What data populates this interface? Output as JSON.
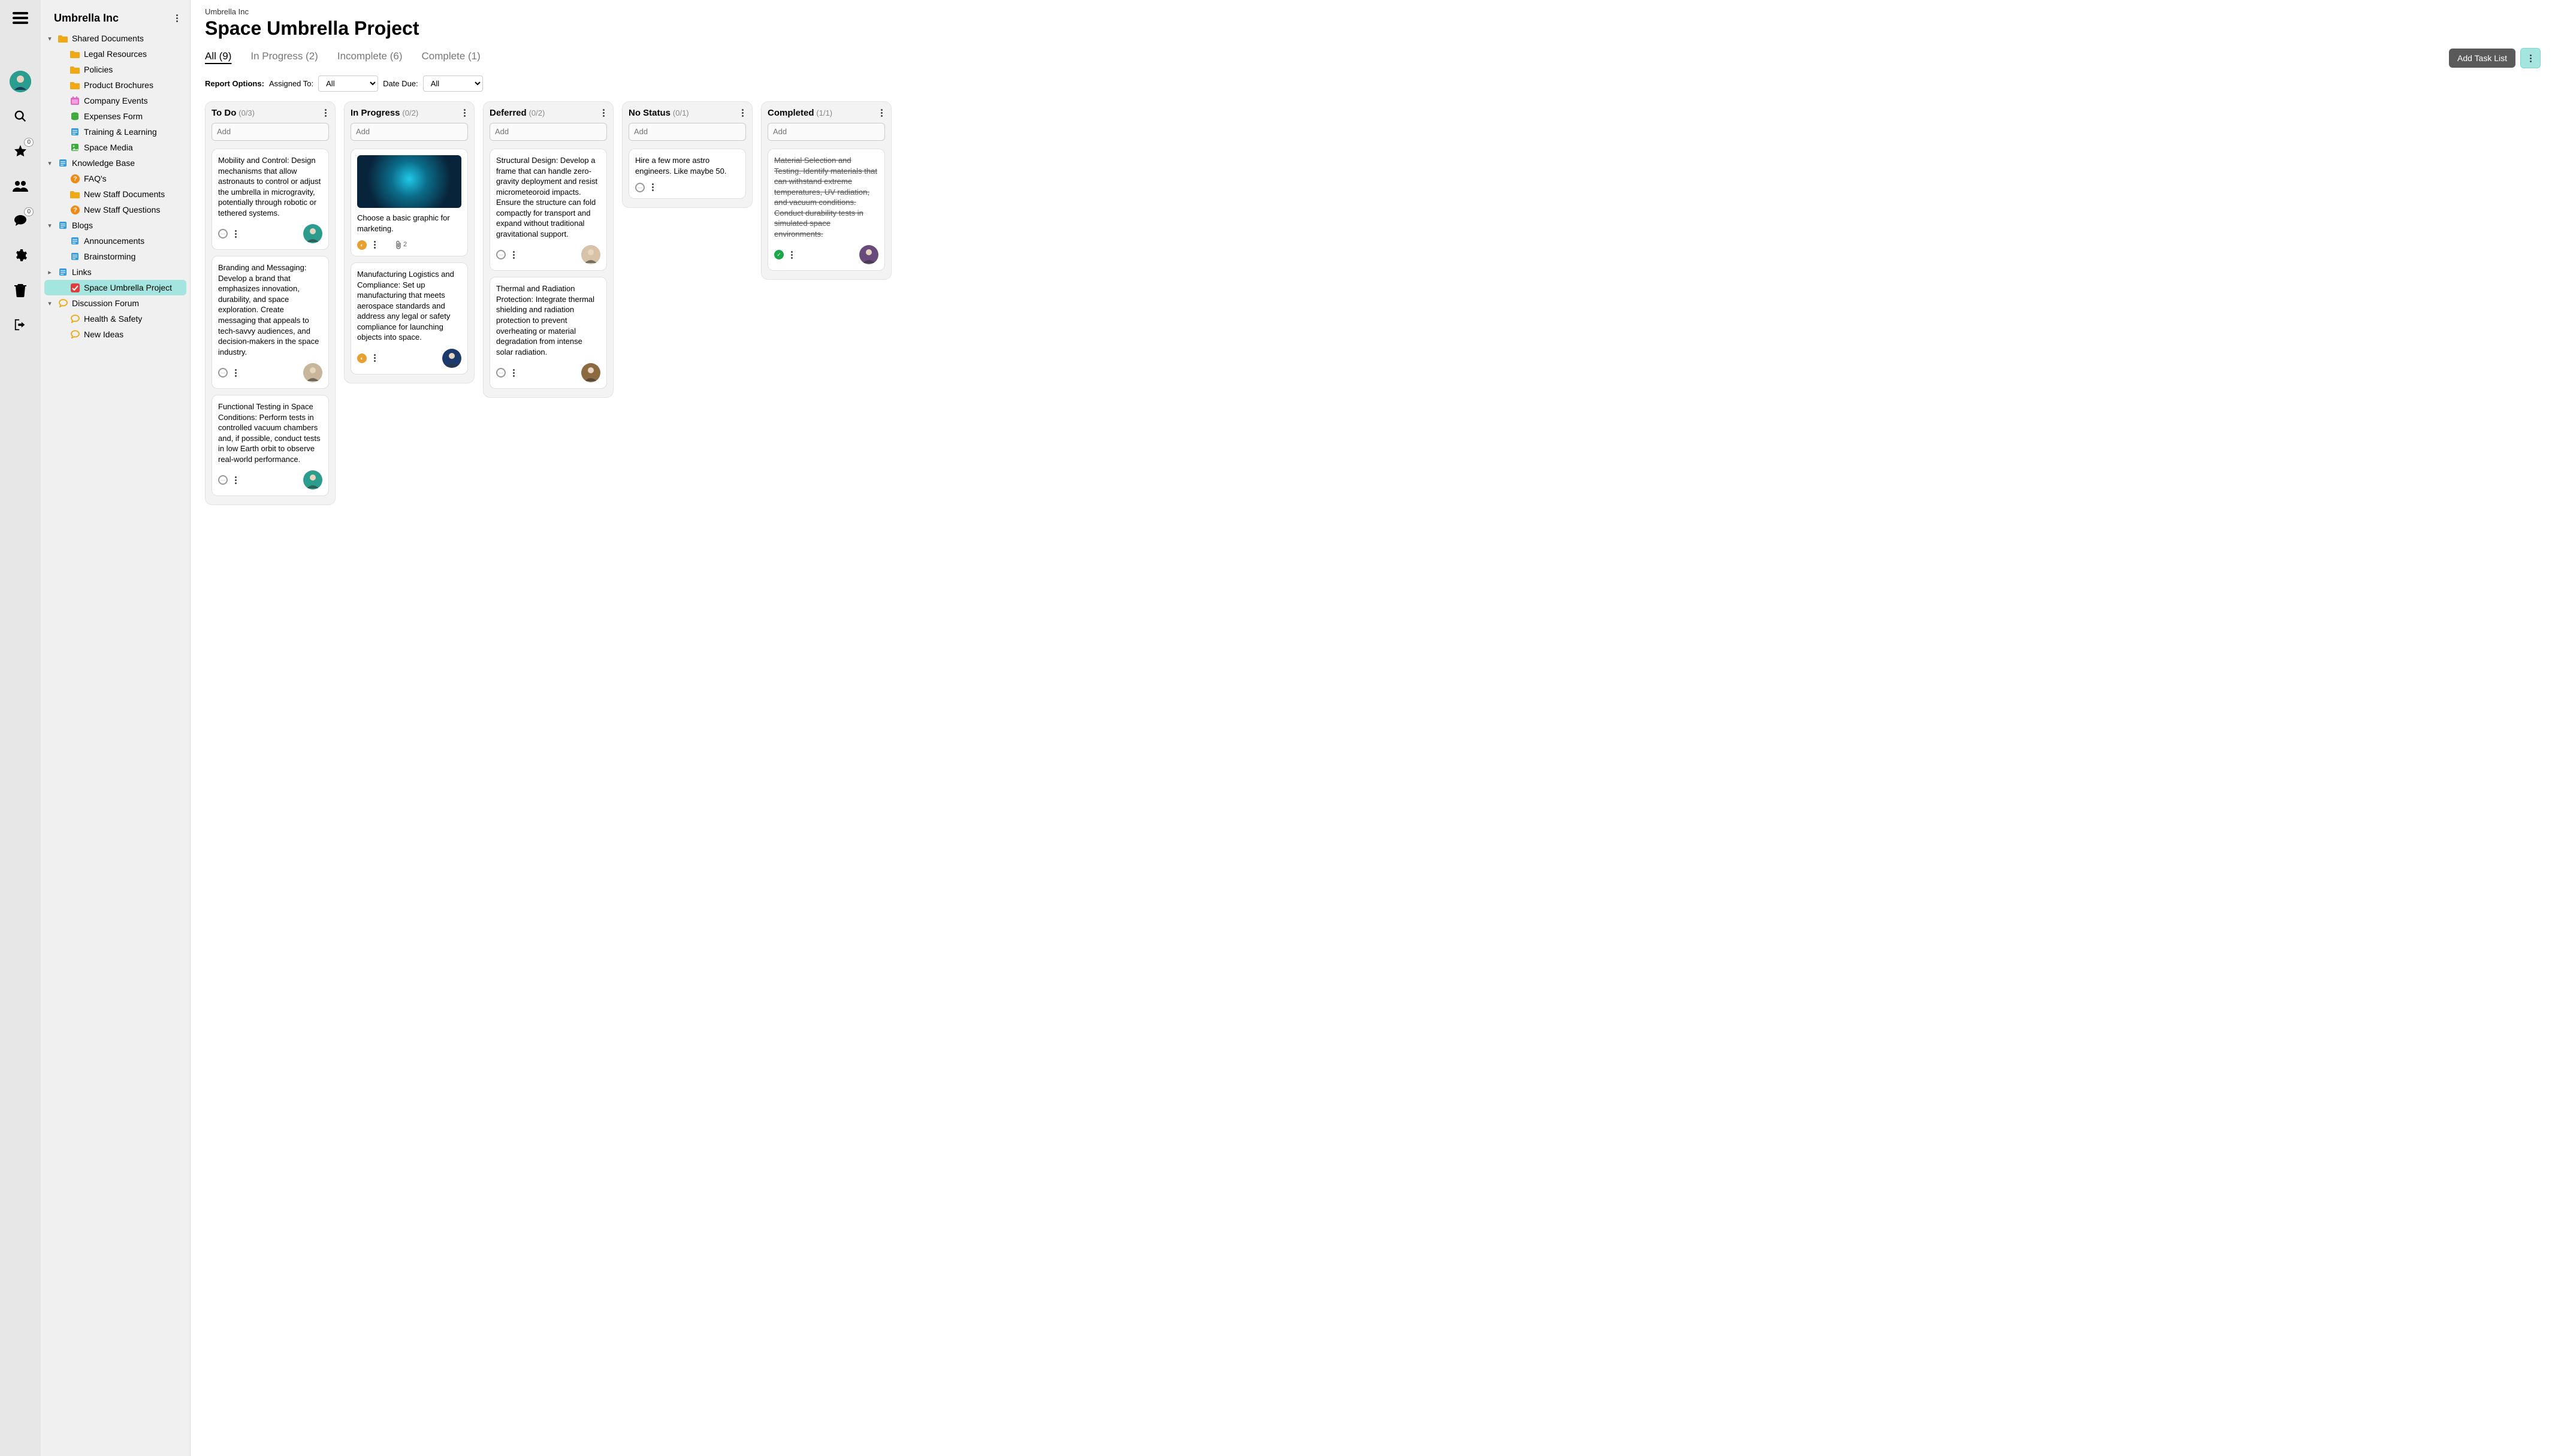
{
  "org": "Umbrella Inc",
  "project_title": "Space Umbrella Project",
  "rail": {
    "star_badge": "0",
    "chat_badge": "0"
  },
  "tree": {
    "nodes": [
      {
        "depth": 0,
        "caret": "▾",
        "icon": "folder",
        "iconClass": "folder-yellow",
        "label": "Shared Documents"
      },
      {
        "depth": 1,
        "caret": "",
        "icon": "folder",
        "iconClass": "folder-yellow",
        "label": "Legal Resources"
      },
      {
        "depth": 1,
        "caret": "",
        "icon": "folder",
        "iconClass": "folder-yellow",
        "label": "Policies"
      },
      {
        "depth": 1,
        "caret": "",
        "icon": "folder",
        "iconClass": "folder-yellow",
        "label": "Product Brochures"
      },
      {
        "depth": 1,
        "caret": "",
        "icon": "calendar",
        "iconClass": "cal-icon",
        "label": "Company Events"
      },
      {
        "depth": 1,
        "caret": "",
        "icon": "db",
        "iconClass": "green-db",
        "label": "Expenses Form"
      },
      {
        "depth": 1,
        "caret": "",
        "icon": "doc",
        "iconClass": "blue-doc",
        "label": "Training & Learning"
      },
      {
        "depth": 1,
        "caret": "",
        "icon": "image",
        "iconClass": "green-img",
        "label": "Space Media"
      },
      {
        "depth": 0,
        "caret": "▾",
        "icon": "doc",
        "iconClass": "blue-doc",
        "label": "Knowledge Base"
      },
      {
        "depth": 1,
        "caret": "",
        "icon": "question",
        "iconClass": "orange-q",
        "label": "FAQ's"
      },
      {
        "depth": 1,
        "caret": "",
        "icon": "folder",
        "iconClass": "folder-yellow",
        "label": "New Staff Documents"
      },
      {
        "depth": 1,
        "caret": "",
        "icon": "question",
        "iconClass": "orange-q",
        "label": "New Staff Questions"
      },
      {
        "depth": 0,
        "caret": "▾",
        "icon": "doc",
        "iconClass": "blue-doc",
        "label": "Blogs"
      },
      {
        "depth": 1,
        "caret": "",
        "icon": "doc",
        "iconClass": "blue-doc",
        "label": "Announcements"
      },
      {
        "depth": 1,
        "caret": "",
        "icon": "doc",
        "iconClass": "blue-doc",
        "label": "Brainstorming"
      },
      {
        "depth": 0,
        "caret": "▸",
        "icon": "doc",
        "iconClass": "blue-doc",
        "label": "Links"
      },
      {
        "depth": 1,
        "caret": "",
        "icon": "check",
        "iconClass": "red-check",
        "label": "Space Umbrella Project",
        "active": true
      },
      {
        "depth": 0,
        "caret": "▾",
        "icon": "chat",
        "iconClass": "chat-icon",
        "label": "Discussion Forum"
      },
      {
        "depth": 1,
        "caret": "",
        "icon": "chat",
        "iconClass": "chat-icon",
        "label": "Health & Safety"
      },
      {
        "depth": 1,
        "caret": "",
        "icon": "chat",
        "iconClass": "chat-icon",
        "label": "New Ideas"
      }
    ]
  },
  "tabs": [
    {
      "label": "All (9)",
      "active": true
    },
    {
      "label": "In Progress (2)"
    },
    {
      "label": "Incomplete (6)"
    },
    {
      "label": "Complete (1)"
    }
  ],
  "add_task_list": "Add Task List",
  "filters": {
    "label": "Report Options:",
    "assigned_label": "Assigned To:",
    "assigned_value": "All",
    "due_label": "Date Due:",
    "due_value": "All"
  },
  "add_placeholder": "Add",
  "columns": [
    {
      "title": "To Do",
      "count": "(0/3)",
      "cards": [
        {
          "text": "Mobility and Control: Design mechanisms that allow astronauts to control or adjust the umbrella in microgravity, potentially through robotic or tethered systems.",
          "status": "none",
          "avatarColor": "#2a9d8f"
        },
        {
          "text": "Branding and Messaging: Develop a brand that emphasizes innovation, durability, and space exploration. Create messaging that appeals to tech-savvy audiences, and decision-makers in the space industry.",
          "status": "none",
          "avatarColor": "#c9b59a"
        },
        {
          "text": "Functional Testing in Space Conditions: Perform tests in controlled vacuum chambers and, if possible, conduct tests in low Earth orbit to observe real-world performance.",
          "status": "none",
          "avatarColor": "#2a9d8f"
        }
      ]
    },
    {
      "title": "In Progress",
      "count": "(0/2)",
      "cards": [
        {
          "text": "Choose a basic graphic for marketing.",
          "status": "orange",
          "hasImage": true,
          "attachCount": "2"
        },
        {
          "text": "Manufacturing Logistics and Compliance: Set up manufacturing that meets aerospace standards and address any legal or safety compliance for launching objects into space.",
          "status": "orange",
          "avatarColor": "#1b3a6b"
        }
      ]
    },
    {
      "title": "Deferred",
      "count": "(0/2)",
      "cards": [
        {
          "text": "Structural Design: Develop a frame that can handle zero-gravity deployment and resist micrometeoroid impacts. Ensure the structure can fold compactly for transport and expand without traditional gravitational support.",
          "status": "none",
          "avatarColor": "#d8c3a8"
        },
        {
          "text": "Thermal and Radiation Protection: Integrate thermal shielding and radiation protection to prevent overheating or material degradation from intense solar radiation.",
          "status": "none",
          "avatarColor": "#8b6a3f"
        }
      ]
    },
    {
      "title": "No Status",
      "count": "(0/1)",
      "cards": [
        {
          "text": "Hire a few more astro engineers. Like maybe 50.",
          "status": "none"
        }
      ]
    },
    {
      "title": "Completed",
      "count": "(1/1)",
      "cards": [
        {
          "text": "Material Selection and Testing. Identify materials that can withstand extreme temperatures, UV radiation, and vacuum conditions. Conduct durability tests in simulated space environments.",
          "status": "green",
          "done": true,
          "avatarColor": "#6a4a7c"
        }
      ]
    }
  ]
}
